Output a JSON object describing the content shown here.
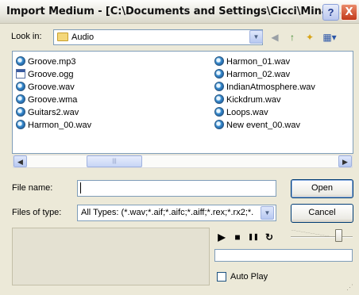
{
  "window": {
    "title": "Import Medium - [C:\\Documents and Settings\\Cicci\\Mina ...",
    "help_glyph": "?",
    "close_glyph": "X"
  },
  "look_in": {
    "label": "Look in:",
    "value": "Audio",
    "folder_icon": "folder-icon",
    "arrow": "▼"
  },
  "toolbar": {
    "back_icon": "back-icon",
    "up_icon": "up-folder-icon",
    "new_folder_icon": "new-folder-icon",
    "views_icon": "views-menu-icon",
    "back_glyph": "◀",
    "up_glyph": "↑",
    "new_glyph": "✦",
    "views_glyph": "▦▾"
  },
  "files": {
    "col1": [
      {
        "name": "Groove.mp3",
        "icon": "audio-file-icon"
      },
      {
        "name": "Groove.ogg",
        "icon": "ogg-file-icon"
      },
      {
        "name": "Groove.wav",
        "icon": "audio-file-icon"
      },
      {
        "name": "Groove.wma",
        "icon": "audio-file-icon"
      },
      {
        "name": "Guitars2.wav",
        "icon": "audio-file-icon"
      },
      {
        "name": "Harmon_00.wav",
        "icon": "audio-file-icon"
      }
    ],
    "col2": [
      {
        "name": "Harmon_01.wav",
        "icon": "audio-file-icon"
      },
      {
        "name": "Harmon_02.wav",
        "icon": "audio-file-icon"
      },
      {
        "name": "IndianAtmosphere.wav",
        "icon": "audio-file-icon"
      },
      {
        "name": "Kickdrum.wav",
        "icon": "audio-file-icon"
      },
      {
        "name": "Loops.wav",
        "icon": "audio-file-icon"
      },
      {
        "name": "New event_00.wav",
        "icon": "audio-file-icon"
      }
    ]
  },
  "scrollbar": {
    "left_glyph": "◀",
    "right_glyph": "▶",
    "thumb_grip": "|||"
  },
  "file_name": {
    "label": "File name:",
    "value": ""
  },
  "file_type": {
    "label": "Files of type:",
    "value": "All Types: (*.wav;*.aif;*.aifc;*.aiff;*.rex;*.rx2;*."
  },
  "buttons": {
    "open": "Open",
    "cancel": "Cancel"
  },
  "playback": {
    "play_glyph": "▶",
    "stop_glyph": "■",
    "pause_glyph": "❚❚",
    "loop_glyph": "↻",
    "volume_level": 0.75,
    "auto_play_label": "Auto Play",
    "auto_play_checked": false
  },
  "colors": {
    "dialog_bg": "#ECE9D8",
    "input_border": "#7F9DB9",
    "close_red": "#C2391A"
  }
}
